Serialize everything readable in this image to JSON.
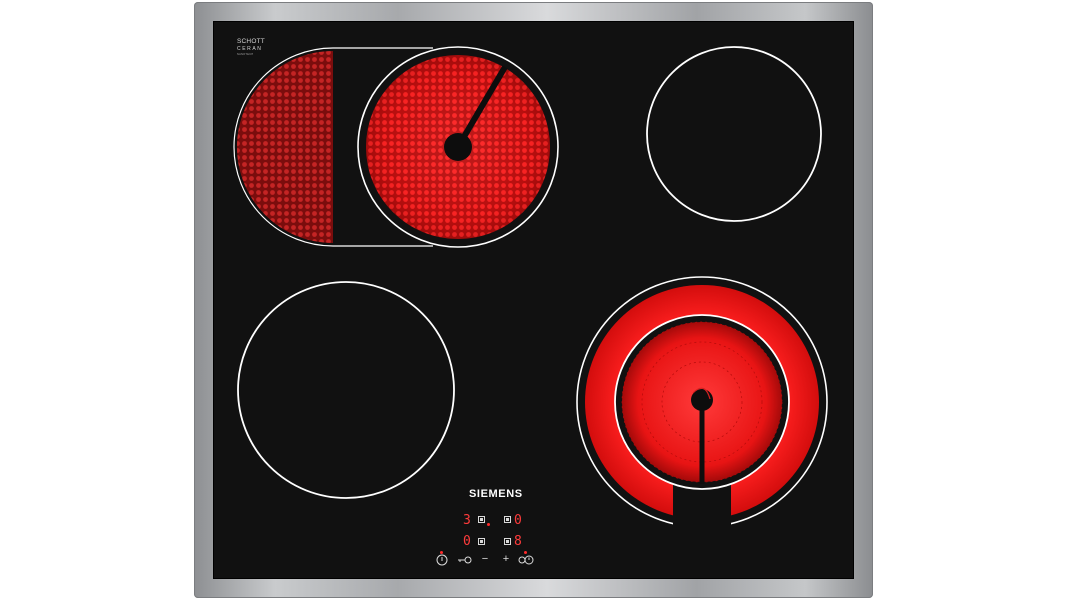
{
  "badge": {
    "line1": "SCHOTT",
    "line2": "CERAN",
    "line3": "NANOTECH"
  },
  "brand": {
    "logo": "SIEMENS"
  },
  "zones": [
    {
      "id": "front-left-top",
      "state": "on",
      "type": "dual-extended"
    },
    {
      "id": "rear-right",
      "state": "off"
    },
    {
      "id": "front-left",
      "state": "off"
    },
    {
      "id": "front-right",
      "state": "on",
      "type": "dual-ring"
    }
  ],
  "controls": {
    "display_top_left": "3",
    "display_top_right": "0",
    "display_bottom_left": "0",
    "display_bottom_right": "8",
    "icons": [
      "power-icon",
      "lock-icon",
      "minus-icon",
      "plus-icon",
      "timer-icon"
    ],
    "minus": "−",
    "plus": "+"
  },
  "colors": {
    "glow": "#ff1f1f",
    "glass": "#111111",
    "ring": "#ffffff"
  }
}
